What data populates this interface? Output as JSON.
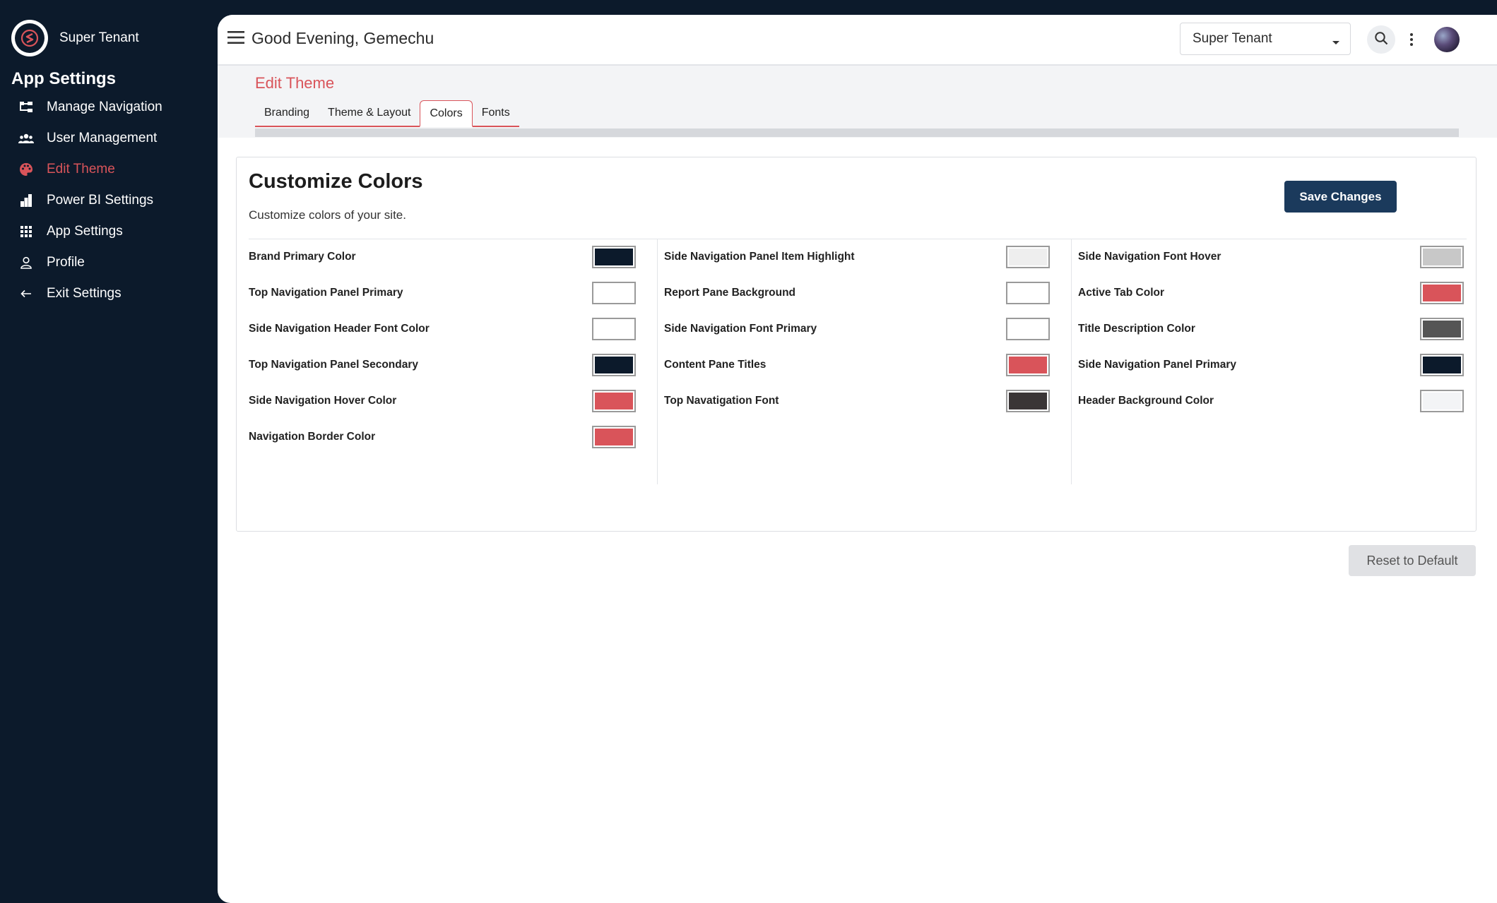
{
  "sidebar": {
    "brand_name": "Super Tenant",
    "section_title": "App Settings",
    "items": [
      {
        "label": "Manage Navigation",
        "icon": "sitemap-icon",
        "active": false
      },
      {
        "label": "User Management",
        "icon": "users-icon",
        "active": false
      },
      {
        "label": "Edit Theme",
        "icon": "palette-icon",
        "active": true
      },
      {
        "label": "Power BI Settings",
        "icon": "bar-chart-icon",
        "active": false
      },
      {
        "label": "App Settings",
        "icon": "grid-icon",
        "active": false
      },
      {
        "label": "Profile",
        "icon": "user-icon",
        "active": false
      },
      {
        "label": "Exit Settings",
        "icon": "arrow-left-icon",
        "active": false
      }
    ]
  },
  "header": {
    "greeting": "Good Evening, Gemechu",
    "tenant_selected": "Super Tenant"
  },
  "page": {
    "title": "Edit Theme",
    "tabs": [
      {
        "label": "Branding",
        "active": false
      },
      {
        "label": "Theme & Layout",
        "active": false
      },
      {
        "label": "Colors",
        "active": true
      },
      {
        "label": "Fonts",
        "active": false
      }
    ]
  },
  "card": {
    "title": "Customize Colors",
    "description": "Customize colors of your site.",
    "save_label": "Save Changes",
    "columns": [
      [
        {
          "label": "Brand Primary Color",
          "color": "#0c1a2b"
        },
        {
          "label": "Top Navigation Panel Primary",
          "color": "#ffffff"
        },
        {
          "label": "Side Navigation Header Font Color",
          "color": "#ffffff"
        },
        {
          "label": "Top Navigation Panel Secondary",
          "color": "#0c1a2b"
        },
        {
          "label": "Side Navigation Hover Color",
          "color": "#d9545a"
        },
        {
          "label": "Navigation Border Color",
          "color": "#d9545a"
        }
      ],
      [
        {
          "label": "Side Navigation Panel Item Highlight",
          "color": "#eeeeee"
        },
        {
          "label": "Report Pane Background",
          "color": "#ffffff"
        },
        {
          "label": "Side Navigation Font Primary",
          "color": "#ffffff"
        },
        {
          "label": "Content Pane Titles",
          "color": "#d9545a"
        },
        {
          "label": "Top Navatigation Font",
          "color": "#3a3536"
        }
      ],
      [
        {
          "label": "Side Navigation Font Hover",
          "color": "#c8c8c8"
        },
        {
          "label": "Active Tab Color",
          "color": "#d9545a"
        },
        {
          "label": "Title Description Color",
          "color": "#555555"
        },
        {
          "label": "Side Navigation Panel Primary",
          "color": "#0c1a2b"
        },
        {
          "label": "Header Background Color",
          "color": "#f3f4f6"
        }
      ]
    ]
  },
  "reset_label": "Reset to Default"
}
